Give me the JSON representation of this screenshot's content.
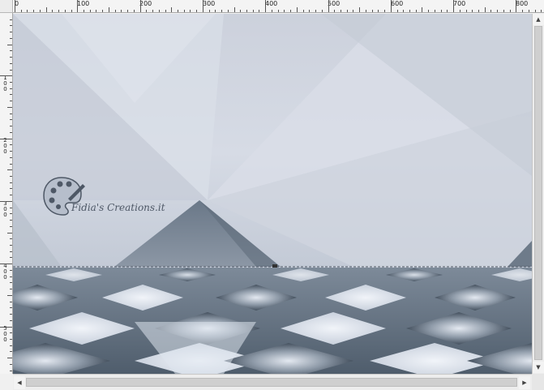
{
  "ruler": {
    "top_labels": [
      "0",
      "100",
      "200",
      "300",
      "400",
      "500",
      "600",
      "700",
      "800"
    ],
    "left_labels": [
      "1 0 0",
      "2 0 0",
      "3 0 0",
      "4 0 0",
      "5 0 0"
    ]
  },
  "canvas": {
    "watermark": "Fidia's Creations.it",
    "palette_icon": "paint-palette-icon"
  },
  "scrollbars": {
    "up": "▲",
    "down": "▼",
    "left": "◀",
    "right": "▶"
  },
  "colors": {
    "sky": "#d3d8e3",
    "floor_dark": "#5f6f80",
    "tile_light": "#dfe5ef"
  }
}
